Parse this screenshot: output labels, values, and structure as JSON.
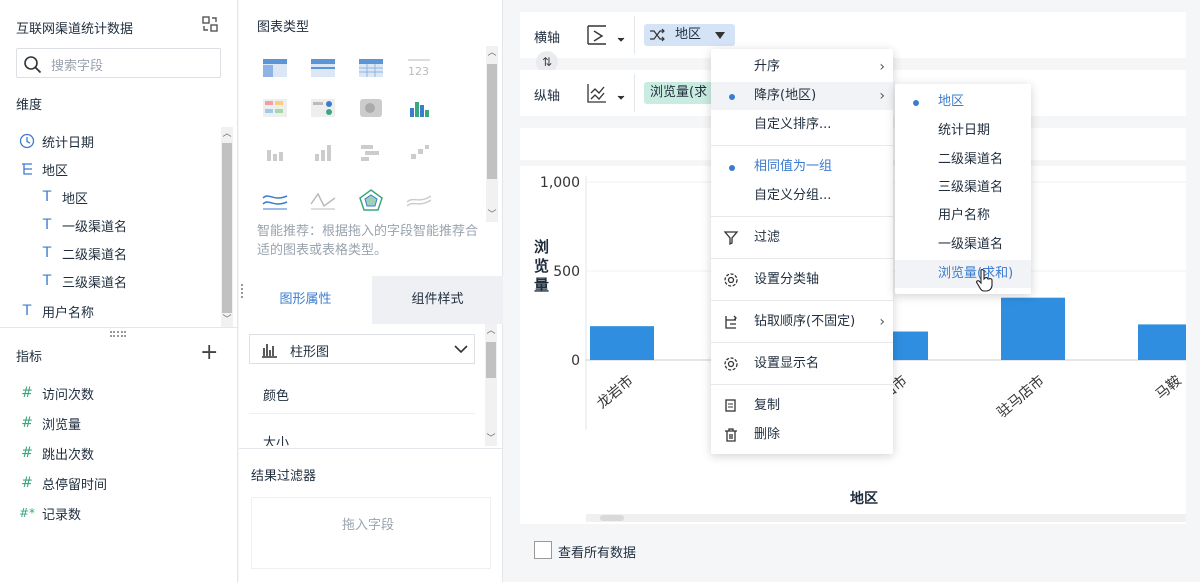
{
  "left": {
    "title": "互联网渠道统计数据",
    "search_placeholder": "搜索字段",
    "dimension_header": "维度",
    "dimensions": [
      {
        "label": "统计日期",
        "icon": "clock-icon"
      },
      {
        "label": "地区",
        "icon": "tree-icon"
      },
      {
        "label": "地区",
        "icon": "text-icon"
      },
      {
        "label": "一级渠道名",
        "icon": "text-icon"
      },
      {
        "label": "二级渠道名",
        "icon": "text-icon"
      },
      {
        "label": "三级渠道名",
        "icon": "text-icon"
      },
      {
        "label": "用户名称",
        "icon": "text-icon"
      }
    ],
    "measure_header": "指标",
    "add_symbol": "+",
    "measures": [
      {
        "label": "访问次数",
        "icon": "#"
      },
      {
        "label": "浏览量",
        "icon": "#"
      },
      {
        "label": "跳出次数",
        "icon": "#"
      },
      {
        "label": "总停留时间",
        "icon": "#"
      },
      {
        "label": "记录数",
        "icon": "#*"
      }
    ]
  },
  "mid": {
    "chart_type_header": "图表类型",
    "recommend_text": "智能推荐：根据拖入的字段智能推荐合适的图表或表格类型。",
    "tabs": [
      "图形属性",
      "组件样式"
    ],
    "chart_select": "柱形图",
    "props": [
      "颜色",
      "大小"
    ],
    "filter_header": "结果过滤器",
    "drop_hint": "拖入字段"
  },
  "axes": {
    "x_label": "横轴",
    "y_label": "纵轴",
    "x_pill": "地区",
    "y_pill": "浏览量(求"
  },
  "chart": {
    "y_title": "浏览量",
    "x_title": "地区",
    "show_all": "查看所有数据"
  },
  "chart_data": {
    "type": "bar",
    "categories": [
      "龙岩市",
      "?",
      "衡山市",
      "驻马店市",
      "马鞍"
    ],
    "values": [
      190,
      0,
      160,
      350,
      200
    ],
    "ylim": [
      0,
      1000
    ],
    "yticks": [
      "1,000",
      "500",
      "0"
    ],
    "xlabel": "地区",
    "ylabel": "浏览量",
    "bar_color": "#2f8ee0"
  },
  "menu": {
    "items": [
      {
        "label": "升序",
        "sub": true
      },
      {
        "label": "降序(地区)",
        "sub": true,
        "dot": true
      },
      {
        "label": "自定义排序..."
      },
      {
        "label": "相同值为一组",
        "dot": true,
        "blue": true
      },
      {
        "label": "自定义分组..."
      },
      {
        "label": "过滤",
        "icon": "filter-icon"
      },
      {
        "label": "设置分类轴",
        "icon": "gear-icon"
      },
      {
        "label": "钻取顺序(不固定)",
        "icon": "drill-icon",
        "sub": true
      },
      {
        "label": "设置显示名",
        "icon": "gear-icon"
      },
      {
        "label": "复制",
        "icon": "copy-icon"
      },
      {
        "label": "删除",
        "icon": "trash-icon"
      }
    ]
  },
  "submenu": {
    "items": [
      "地区",
      "统计日期",
      "二级渠道名",
      "三级渠道名",
      "用户名称",
      "一级渠道名",
      "浏览量(求和)"
    ]
  }
}
